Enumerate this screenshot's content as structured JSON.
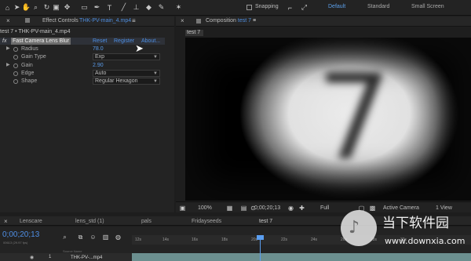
{
  "toolbar": {
    "tools": [
      "home-icon",
      "selection-icon",
      "hand-icon",
      "zoom-icon",
      "rotate-icon",
      "camera-icon",
      "pan-behind-icon",
      "mask-icon",
      "pen-icon",
      "type-icon",
      "brush-icon",
      "clone-stamp-icon",
      "eraser-icon",
      "roto-brush-icon",
      "puppet-pin-icon"
    ],
    "snapping_label": "Snapping",
    "workspaces": [
      "Default",
      "Standard",
      "Small Screen"
    ]
  },
  "effect_controls": {
    "tab_title": "Effect Controls",
    "tab_layer": "THK-PV-main_4.mp4",
    "menu": "≡",
    "crumb": "test 7 • THK-PV-main_4.mp4",
    "effect": {
      "fx_mark": "fx",
      "name": "Fast Camera Lens Blur",
      "links": [
        "Reset",
        "Register",
        "About..."
      ]
    },
    "properties": [
      {
        "label": "Radius",
        "value": "78.0",
        "kind": "value"
      },
      {
        "label": "Gain Type",
        "value": "Exp",
        "kind": "dropdown"
      },
      {
        "label": "Gain",
        "value": "2.90",
        "kind": "value"
      },
      {
        "label": "Edge",
        "value": "Auto",
        "kind": "dropdown"
      },
      {
        "label": "Shape",
        "value": "Regular Hexagon",
        "kind": "dropdown"
      }
    ]
  },
  "composition": {
    "tab_title": "Composition",
    "tab_name": "test 7",
    "viewer_tab": "test 7",
    "viewer_numeral": "7",
    "footer": {
      "zoom": "100%",
      "timecode": "0;00;20;13",
      "resolution": "Full",
      "camera": "Active Camera",
      "views": "1 View"
    }
  },
  "timeline": {
    "tabs": [
      "Lenscare",
      "lens_std (1)",
      "pals",
      "Fridayseeds",
      "test 7"
    ],
    "timecode": "0;00;20;13",
    "timecode_sub": "00613 (29.97 fps)",
    "ticks": [
      "12s",
      "14s",
      "16s",
      "18s",
      "20s",
      "22s",
      "24s",
      "26s",
      "28s",
      "30s"
    ],
    "source_header": "Source Name",
    "layer_name": "THK-PV-...mp4"
  },
  "watermark": {
    "logo_char": "♪",
    "line1": "当下软件园",
    "line2": "www.downxia.com"
  }
}
